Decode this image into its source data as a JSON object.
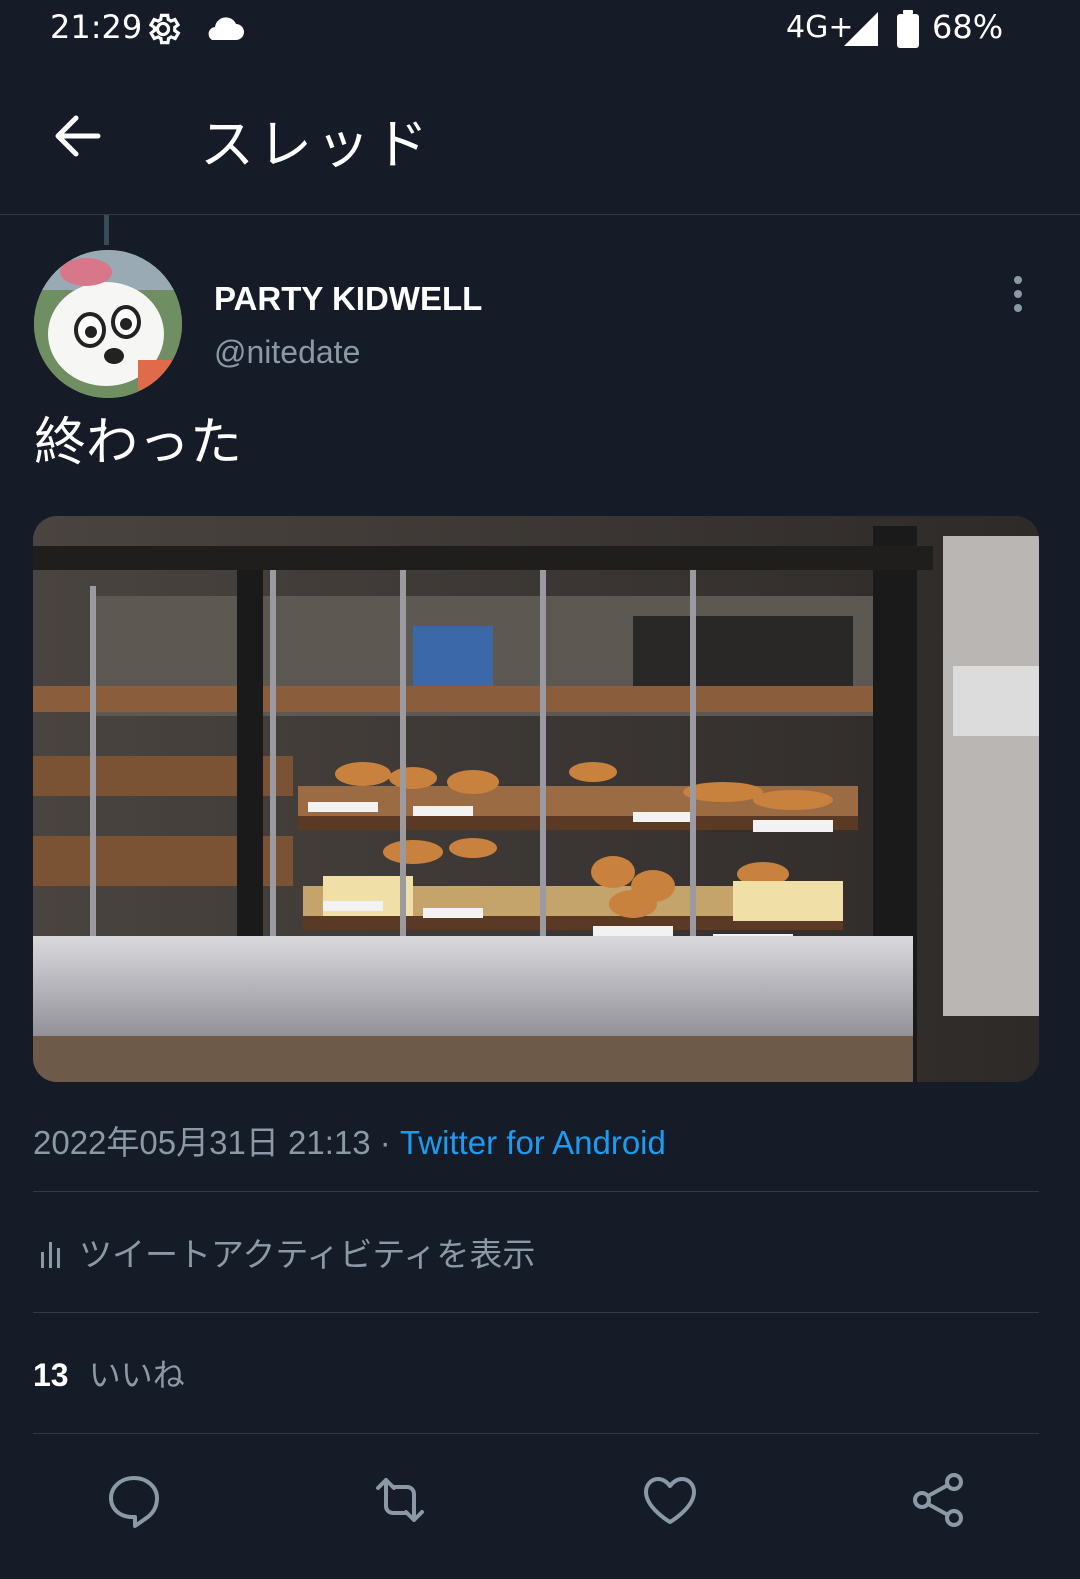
{
  "status_bar": {
    "time": "21:29",
    "network": "4G+",
    "battery": "68%",
    "icons": [
      "gear-icon",
      "cloud-icon",
      "signal-icon",
      "battery-icon"
    ]
  },
  "header": {
    "title": "スレッド",
    "back_icon": "arrow-left-icon"
  },
  "tweet": {
    "author_name": "PARTY KIDWELL",
    "author_handle": "@nitedate",
    "text": "終わった",
    "date": "2022年05月31日 21:13",
    "separator": "·",
    "source": "Twitter for Android",
    "activity_label": "ツイートアクティビティを表示",
    "likes_count": "13",
    "likes_label": "いいね"
  },
  "actions": [
    "reply-icon",
    "retweet-icon",
    "like-icon",
    "share-icon"
  ],
  "colors": {
    "background": "#151c27",
    "accent": "#1d9bf0",
    "muted": "#8b98a5",
    "divider": "#2f3a48"
  }
}
